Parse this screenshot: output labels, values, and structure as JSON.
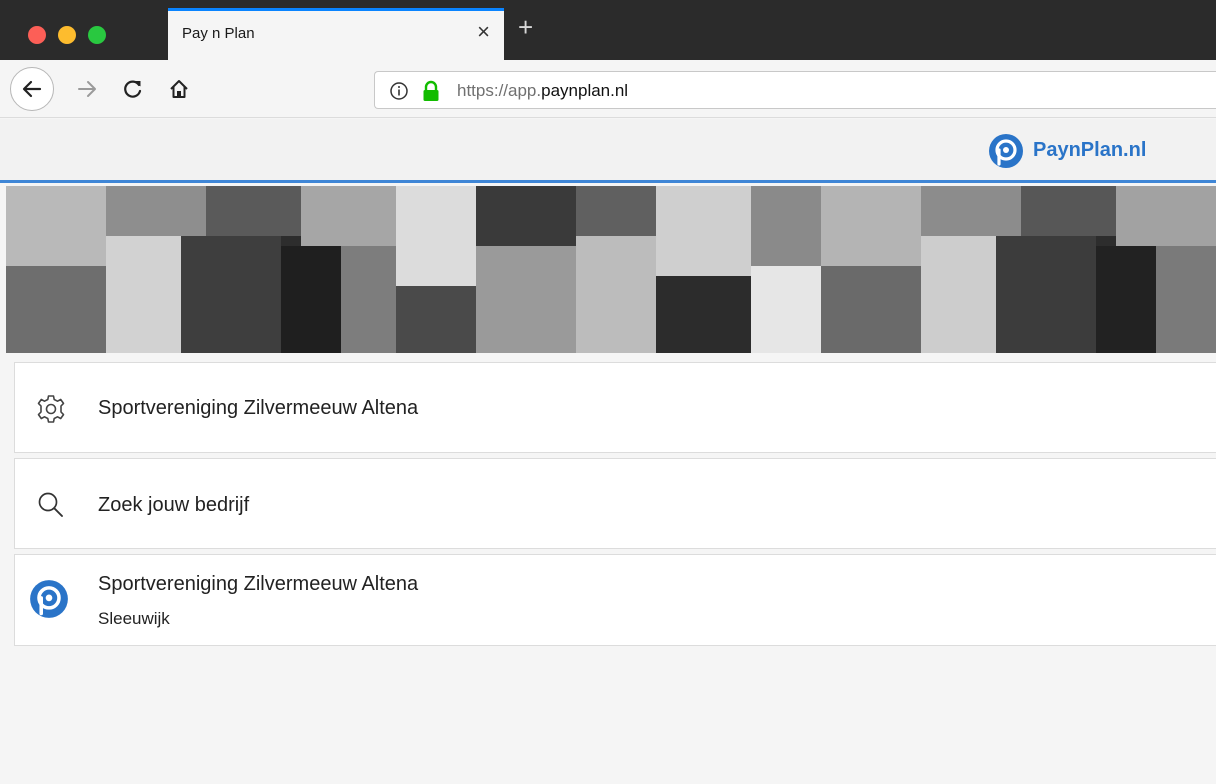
{
  "browser": {
    "tab_title": "Pay n Plan",
    "close_glyph": "×",
    "newtab_glyph": "+",
    "url_prefix": "https://app.",
    "url_domain": "paynplan.nl",
    "icons": [
      "back-arrow-icon",
      "forward-arrow-icon",
      "reload-icon",
      "home-icon",
      "info-icon",
      "lock-icon",
      "close-icon",
      "plus-icon"
    ]
  },
  "header": {
    "logo_text": "PaynPlan.nl",
    "brand_color": "#2a74c8"
  },
  "settings_row": {
    "label": "Sportvereniging Zilvermeeuw Altena",
    "icon": "gear-icon"
  },
  "search": {
    "placeholder": "Zoek jouw bedrijf",
    "value": "",
    "icon": "search-icon"
  },
  "results": [
    {
      "name": "Sportvereniging Zilvermeeuw Altena",
      "location": "Sleeuwijk",
      "icon": "paynplan-logo-icon"
    }
  ]
}
